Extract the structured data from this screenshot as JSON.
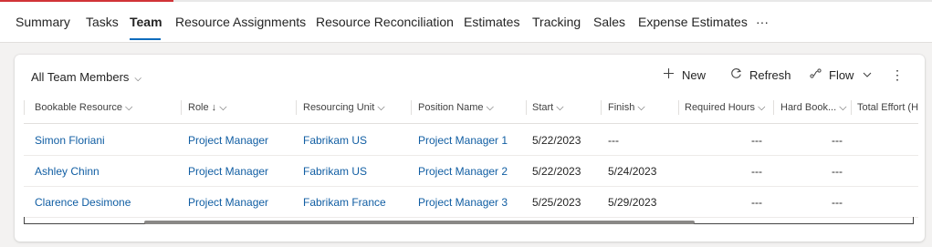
{
  "tabs": [
    "Summary",
    "Tasks",
    "Team",
    "Resource Assignments",
    "Resource Reconciliation",
    "Estimates",
    "Tracking",
    "Sales",
    "Expense Estimates",
    "···"
  ],
  "active_tab": "Team",
  "grid": {
    "view_title": "All Team Members",
    "view_chevron": "⌵",
    "commands": {
      "new": "New",
      "refresh": "Refresh",
      "flow": "Flow",
      "more": "⋮"
    },
    "columns": [
      "Bookable Resource ⌵",
      "Role ↓ ⌵",
      "Resourcing Unit ⌵",
      "Position Name ⌵",
      "Start ⌵",
      "Finish ⌵",
      "Required Hours ⌵",
      "Hard Book... ⌵",
      "Total Effort (H"
    ],
    "rows": [
      {
        "resource": "Simon Floriani",
        "role": "Project Manager",
        "unit": "Fabrikam US",
        "position": "Project Manager 1",
        "start": "5/22/2023",
        "finish": "---",
        "required": "---",
        "hard": "---"
      },
      {
        "resource": "Ashley Chinn",
        "role": "Project Manager",
        "unit": "Fabrikam US",
        "position": "Project Manager 2",
        "start": "5/22/2023",
        "finish": "5/24/2023",
        "required": "---",
        "hard": "---"
      },
      {
        "resource": "Clarence Desimone",
        "role": "Project Manager",
        "unit": "Fabrikam France",
        "position": "Project Manager 3",
        "start": "5/25/2023",
        "finish": "5/29/2023",
        "required": "---",
        "hard": "---"
      }
    ]
  },
  "colors": {
    "accent": "#0f6cbd",
    "link": "#115ea3",
    "top_progress": "#d13438"
  },
  "icons": {
    "new": "plus-icon",
    "refresh": "refresh-icon",
    "flow": "flow-icon",
    "more": "more-vertical-icon",
    "view": "chevron-down-icon"
  }
}
